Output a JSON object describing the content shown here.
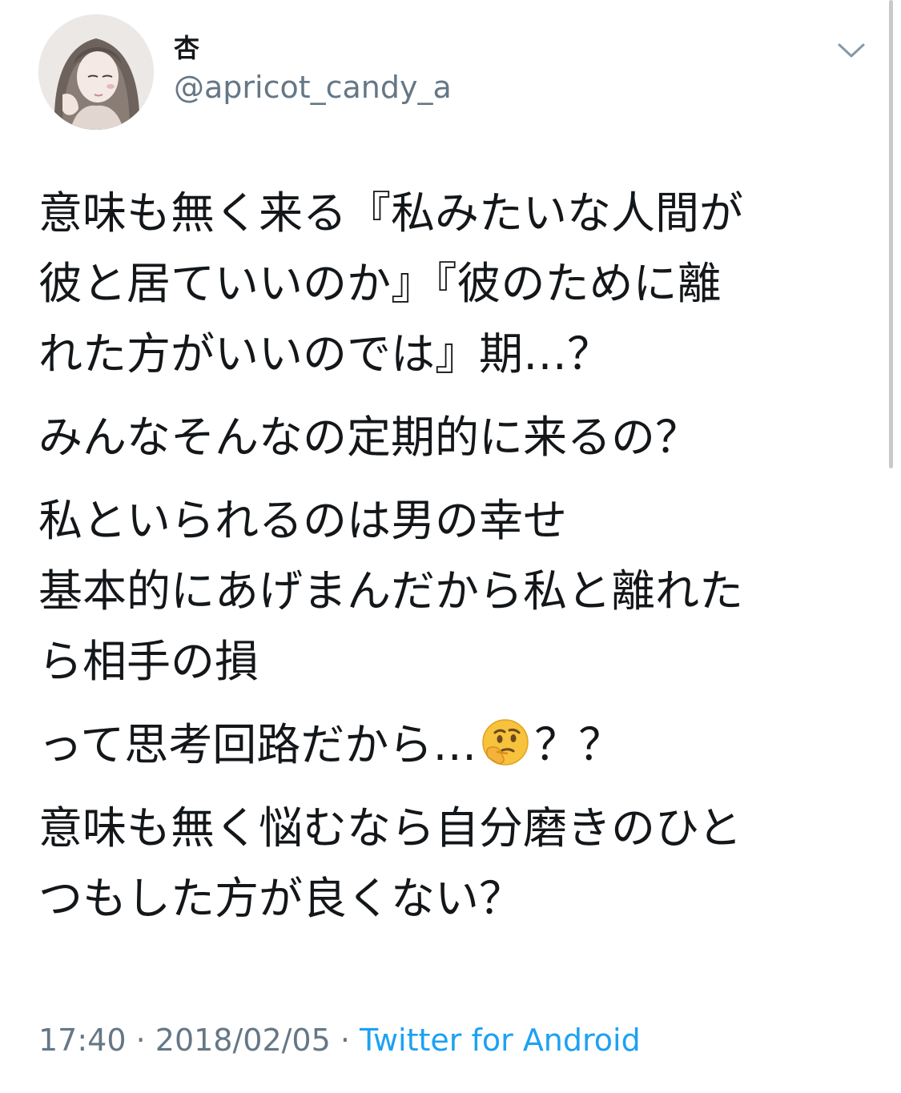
{
  "user": {
    "display_name": "杏",
    "handle": "@apricot_candy_a",
    "avatar_icon": "avatar-illustration"
  },
  "tweet": {
    "paragraphs": [
      [
        "意味も無く来る『私みたいな人間が",
        "彼と居ていいのか』『彼のために離",
        "れた方がいいのでは』期…？"
      ],
      [
        "みんなそんなの定期的に来るの？"
      ],
      [
        "私といられるのは男の幸せ",
        "基本的にあげまんだから私と離れた",
        "ら相手の損"
      ],
      [
        "って思考回路だから…",
        "？？"
      ],
      [
        "意味も無く悩むなら自分磨きのひと",
        "つもした方が良くない？"
      ]
    ],
    "emoji": "thinking-face-icon"
  },
  "meta": {
    "time": "17:40",
    "separator": " · ",
    "date": "2018/02/05",
    "source": "Twitter for Android"
  },
  "colors": {
    "text": "#14171a",
    "secondary": "#657786",
    "link": "#1da1f2"
  }
}
